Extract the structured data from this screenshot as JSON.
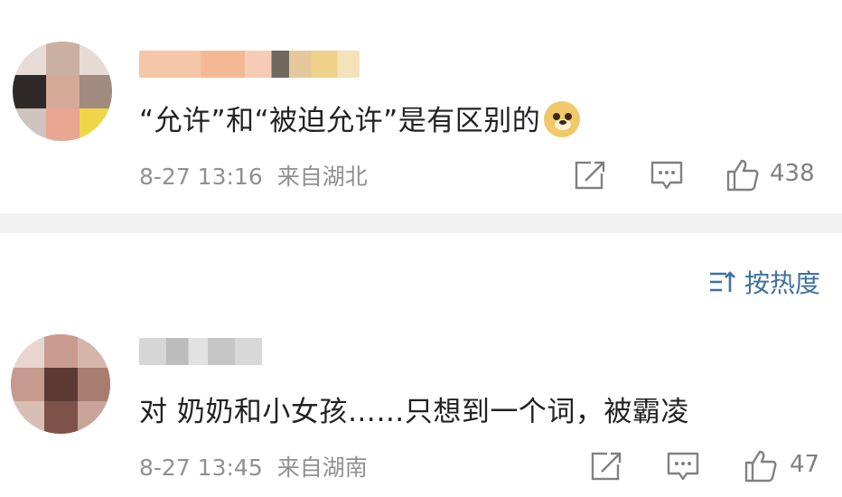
{
  "comments": [
    {
      "text": "“允许”和“被迫允许”是有区别的",
      "emoji": "doge-icon",
      "time": "8-27 13:16",
      "location": "来自湖北",
      "likes": "438"
    },
    {
      "text": "对 奶奶和小女孩……只想到一个词，被霸凌",
      "time": "8-27 13:45",
      "location": "来自湖南",
      "likes": "47"
    }
  ],
  "sort": {
    "label": "按热度",
    "icon": "sort-icon"
  },
  "colors": {
    "text": "#222222",
    "meta": "#909090",
    "icon": "#808080",
    "link": "#3f6f9e",
    "divider": "#f2f2f2"
  }
}
